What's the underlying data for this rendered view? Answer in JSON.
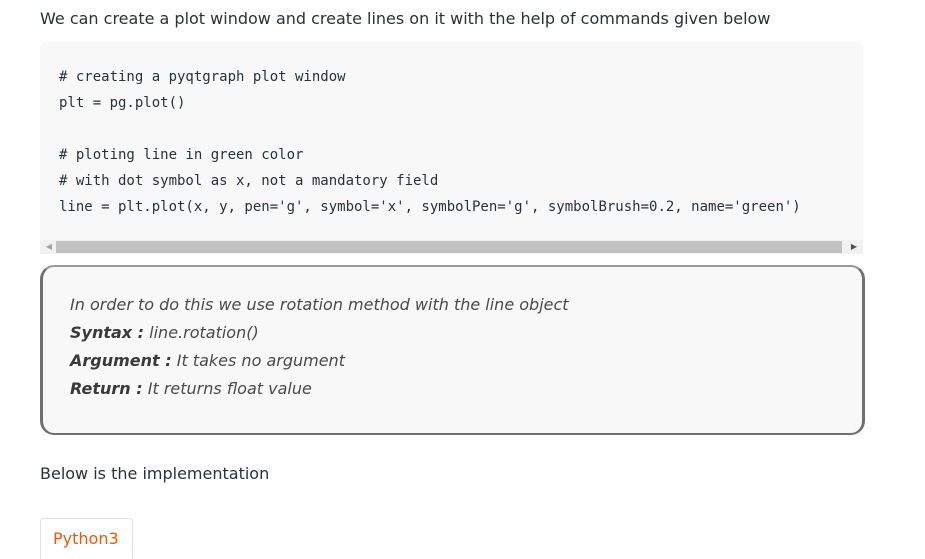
{
  "intro_text": "We can create a plot window and create lines on it with the help of commands given below",
  "code": {
    "lines": [
      "# creating a pyqtgraph plot window",
      "plt = pg.plot()",
      "",
      "# ploting line in green color",
      "# with dot symbol as x, not a mandatory field",
      "line = plt.plot(x, y, pen='g', symbol='x', symbolPen='g', symbolBrush=0.2, name='green')"
    ]
  },
  "note": {
    "description": "In order to do this we use rotation method with the line object",
    "syntax_label": "Syntax :",
    "syntax_value": " line.rotation()",
    "argument_label": "Argument :",
    "argument_value": " It takes no argument",
    "return_label": "Return :",
    "return_value": " It returns float value"
  },
  "below_text": "Below is the implementation",
  "tabs": [
    {
      "label": "Python3"
    }
  ]
}
